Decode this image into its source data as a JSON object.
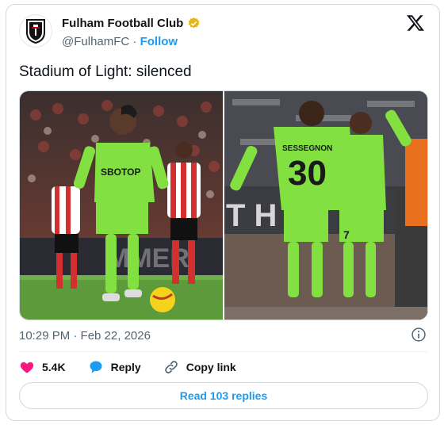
{
  "account": {
    "display_name": "Fulham Football Club",
    "handle": "@FulhamFC",
    "separator": "·",
    "follow_label": "Follow",
    "verified_color": "#e2b719"
  },
  "tweet": {
    "text": "Stadium of Light: silenced",
    "timestamp": "10:29 PM · Feb 22, 2026"
  },
  "media": {
    "left_photo_icon": "football-match-photo-icon",
    "right_photo_icon": "celebration-photo-icon",
    "left_shirt_sponsor": "SBOTOP",
    "right_shirt_name": "SESSEGNON",
    "right_shirt_number": "30",
    "right_shirt_number_2": "7"
  },
  "actions": {
    "likes_count": "5.4K",
    "reply_label": "Reply",
    "copy_link_label": "Copy link",
    "read_replies_label": "Read 103 replies"
  },
  "colors": {
    "link": "#1d9bf0",
    "like": "#f91880",
    "muted": "#536471"
  }
}
